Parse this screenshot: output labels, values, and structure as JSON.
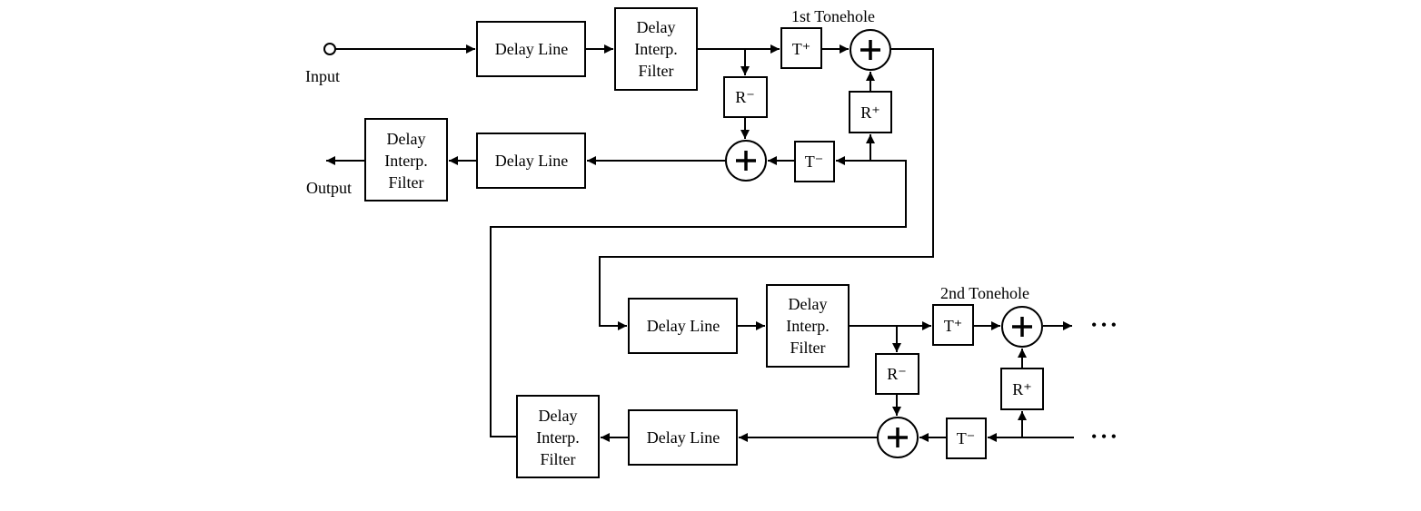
{
  "diagram": {
    "input_label": "Input",
    "output_label": "Output",
    "continuation": "• • •",
    "sections": [
      {
        "tonehole_label": "1st Tonehole",
        "delay_line_forward": "Delay Line",
        "interp_filter_forward": [
          "Delay",
          "Interp.",
          "Filter"
        ],
        "delay_line_backward": "Delay Line",
        "interp_filter_backward": [
          "Delay",
          "Interp.",
          "Filter"
        ],
        "t_plus": "T⁺",
        "t_minus": "T⁻",
        "r_plus": "R⁺",
        "r_minus": "R⁻"
      },
      {
        "tonehole_label": "2nd Tonehole",
        "delay_line_forward": "Delay Line",
        "interp_filter_forward": [
          "Delay",
          "Interp.",
          "Filter"
        ],
        "delay_line_backward": "Delay Line",
        "interp_filter_backward": [
          "Delay",
          "Interp.",
          "Filter"
        ],
        "t_plus": "T⁺",
        "t_minus": "T⁻",
        "r_plus": "R⁺",
        "r_minus": "R⁻"
      }
    ]
  }
}
